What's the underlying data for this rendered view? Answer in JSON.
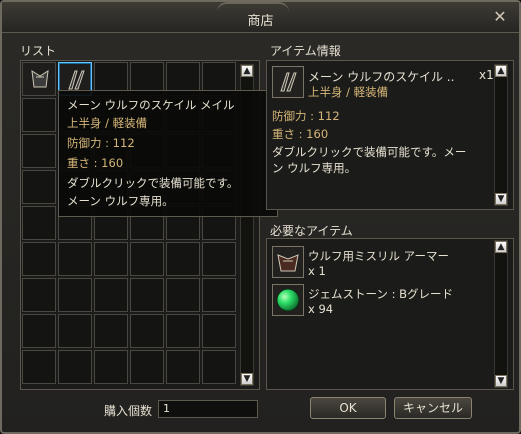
{
  "window": {
    "title": "商店"
  },
  "left_panel": {
    "title": "リスト"
  },
  "tooltip": {
    "name": "メーン ウルフのスケイル メイル",
    "category": "上半身 / 軽装備",
    "defense": "防御力 : 112",
    "weight": "重さ : 160",
    "desc1": "ダブルクリックで装備可能です。",
    "desc2": "メーン ウルフ専用。"
  },
  "item_info": {
    "title": "アイテム情報",
    "name": "メーン ウルフのスケイル ..",
    "quantity": "x1",
    "category": "上半身 / 軽装備",
    "defense": "防御力 : 112",
    "weight": "重さ : 160",
    "desc1": "ダブルクリックで装備可能です。メー",
    "desc2": "ン ウルフ専用。"
  },
  "required_items": {
    "title": "必要なアイテム",
    "items": [
      {
        "name": "ウルフ用ミスリル アーマー",
        "qty": "x 1"
      },
      {
        "name": "ジェムストーン : Bグレード",
        "qty": "x 94"
      }
    ]
  },
  "purchase": {
    "label": "購入個数",
    "value": "1"
  },
  "buttons": {
    "ok": "OK",
    "cancel": "キャンセル"
  },
  "colors": {
    "tooltip_title": "#e7e1d1",
    "stat": "#d5b678",
    "accent": "#63c6ff"
  },
  "icons": {
    "close": "close-icon",
    "item1": "wolf-armor-icon",
    "item2": "scale-armor-icon",
    "gem": "gemstone-icon"
  }
}
